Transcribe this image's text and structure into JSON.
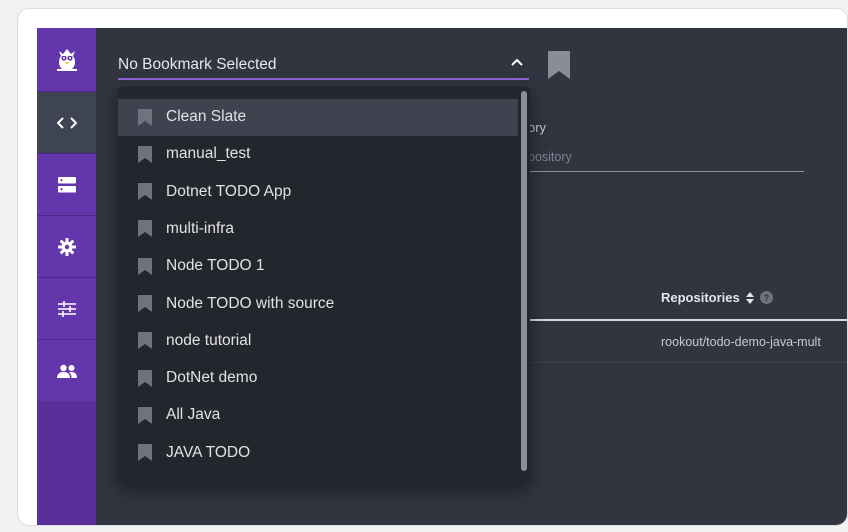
{
  "sidebar": {
    "items": [
      {
        "icon": "code-icon",
        "active": true
      },
      {
        "icon": "servers-icon",
        "active": false
      },
      {
        "icon": "gear-icon",
        "active": false
      },
      {
        "icon": "sliders-icon",
        "active": false
      },
      {
        "icon": "users-icon",
        "active": false
      }
    ],
    "brand_color": "#6336ab"
  },
  "bookmark_select": {
    "value": "No Bookmark Selected",
    "chevron": "chevron-up-icon",
    "accent_color": "#8a63d2"
  },
  "dropdown": {
    "hovered_index": 0,
    "items": [
      "Clean Slate",
      "manual_test",
      "Dotnet TODO App",
      "multi-infra",
      "Node TODO 1",
      "Node TODO with source",
      "node tutorial",
      "DotNet demo",
      "All Java",
      "JAVA TODO"
    ]
  },
  "background": {
    "label_fragment": "ory",
    "input_placeholder_fragment": "pository",
    "table": {
      "column_header": "Repositories",
      "row_value": "rookout/todo-demo-java-mult"
    }
  }
}
